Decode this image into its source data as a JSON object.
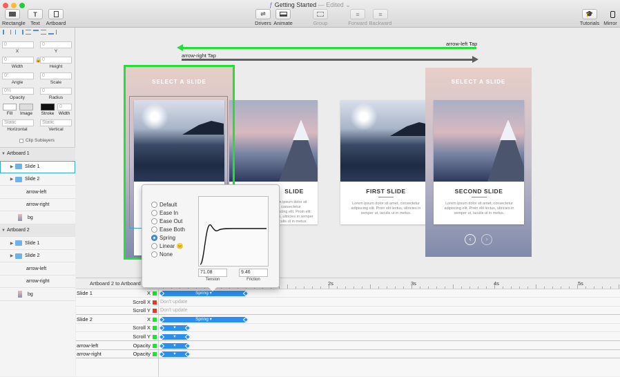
{
  "window": {
    "title": "Getting Started",
    "edited": "— Edited"
  },
  "colors": {
    "green": "#22e035",
    "blue_bar": "#2b8ff0",
    "scroll_red": "#e03a2b",
    "selection_blue": "#3aa5d8"
  },
  "toolbar": {
    "left": [
      {
        "label": "Rectangle",
        "icon": "rectangle-icon"
      },
      {
        "label": "Text",
        "icon": "text-icon"
      },
      {
        "label": "Artboard",
        "icon": "artboard-icon"
      }
    ],
    "center": [
      {
        "label": "Drivers",
        "icon": "drivers-icon"
      },
      {
        "label": "Animate",
        "icon": "animate-icon"
      },
      {
        "label": "Group",
        "icon": "group-icon"
      },
      {
        "label": "Forward",
        "icon": "forward-icon"
      },
      {
        "label": "Backward",
        "icon": "backward-icon"
      }
    ],
    "right": [
      {
        "label": "Tutorials",
        "icon": "tutorials-icon"
      },
      {
        "label": "Mirror",
        "icon": "mirror-icon"
      }
    ]
  },
  "inspector": {
    "x_value": "0",
    "y_value": "0",
    "x_label": "X",
    "y_label": "Y",
    "width_value": "0",
    "height_value": "0",
    "width_label": "Width",
    "height_label": "Height",
    "angle_value": "0°",
    "scale_value": "0",
    "angle_label": "Angle",
    "scale_label": "Scale",
    "opacity_value": "0%",
    "radius_value": "0",
    "opacity_label": "Opacity",
    "radius_label": "Radius",
    "fill_label": "Fill",
    "image_label": "Image",
    "stroke_label": "Stroke",
    "stroke_width_value": "0",
    "stroke_width_label": "Width",
    "horizontal_value": "Static",
    "vertical_value": "Static",
    "horizontal_label": "Horizontal",
    "vertical_label": "Vertical",
    "clip_label": "Clip Sublayers"
  },
  "layers": [
    {
      "name": "Artboard 1",
      "type": "group"
    },
    {
      "name": "Slide 1",
      "type": "folder",
      "selected": true
    },
    {
      "name": "Slide 2",
      "type": "folder"
    },
    {
      "name": "arrow-left",
      "type": "item"
    },
    {
      "name": "arrow-right",
      "type": "item"
    },
    {
      "name": "bg",
      "type": "image"
    },
    {
      "name": "Artboard 2",
      "type": "group"
    },
    {
      "name": "Slide 1",
      "type": "folder"
    },
    {
      "name": "Slide 2",
      "type": "folder"
    },
    {
      "name": "arrow-left",
      "type": "item"
    },
    {
      "name": "arrow-right",
      "type": "item"
    },
    {
      "name": "bg",
      "type": "image"
    }
  ],
  "canvas": {
    "arrow_left_label": "arrow-left Tap",
    "arrow_right_label": "arrow-right Tap",
    "select_title_1": "SELECT A SLIDE",
    "select_title_2": "SELECT A SLIDE",
    "card_partial_title": "SLIDE",
    "card_first_title": "FIRST SLIDE",
    "card_second_title": "SECOND SLIDE",
    "lorem_1": "Lorem ipsum dolor sit amet, consectetur adipiscing elit. Proin elit lectus, ultricies in semper ut, iaculis ut in metus.",
    "lorem_2": "Lorem ipsum dolor sit amet, consectetur adipiscing elit. Proin elit lectus, ultricies in semper ut, iaculis ut in metus.",
    "lorem_3": "Lorem ipsum dolor sit amet, consectetur adipiscing elit. Proin elit lectus, ultricies in semper ut, iaculis ut in metus.",
    "nav_prev": "‹",
    "nav_next": "›"
  },
  "curve_popup": {
    "options": [
      "Default",
      "Ease In",
      "Ease Out",
      "Ease Both",
      "Spring",
      "Linear 😐",
      "None"
    ],
    "selected": "Spring",
    "tension_value": "71.08",
    "tension_label": "Tension",
    "friction_value": "9.46",
    "friction_label": "Friction"
  },
  "timeline": {
    "title": "Artboard 2 to Artboard",
    "ruler": [
      "2s",
      "3s",
      "4s",
      "5s"
    ],
    "rows": [
      {
        "layer": "Slide 1",
        "prop": "X",
        "sq": "green",
        "bar": "Spring ▾"
      },
      {
        "layer": "",
        "prop": "Scroll X",
        "sq": "red",
        "text": "Don't update"
      },
      {
        "layer": "",
        "prop": "Scroll Y",
        "sq": "red",
        "text": "Don't update"
      },
      {
        "layer": "Slide 2",
        "prop": "X",
        "sq": "green",
        "bar": "Spring ▾"
      },
      {
        "layer": "",
        "prop": "Scroll X",
        "sq": "green",
        "bar": "▾"
      },
      {
        "layer": "",
        "prop": "Scroll Y",
        "sq": "green",
        "bar": "▾"
      },
      {
        "layer": "arrow-left",
        "prop": "Opacity",
        "sq": "green",
        "bar": "▾"
      },
      {
        "layer": "arrow-right",
        "prop": "Opacity",
        "sq": "green",
        "bar": "▾"
      }
    ]
  }
}
